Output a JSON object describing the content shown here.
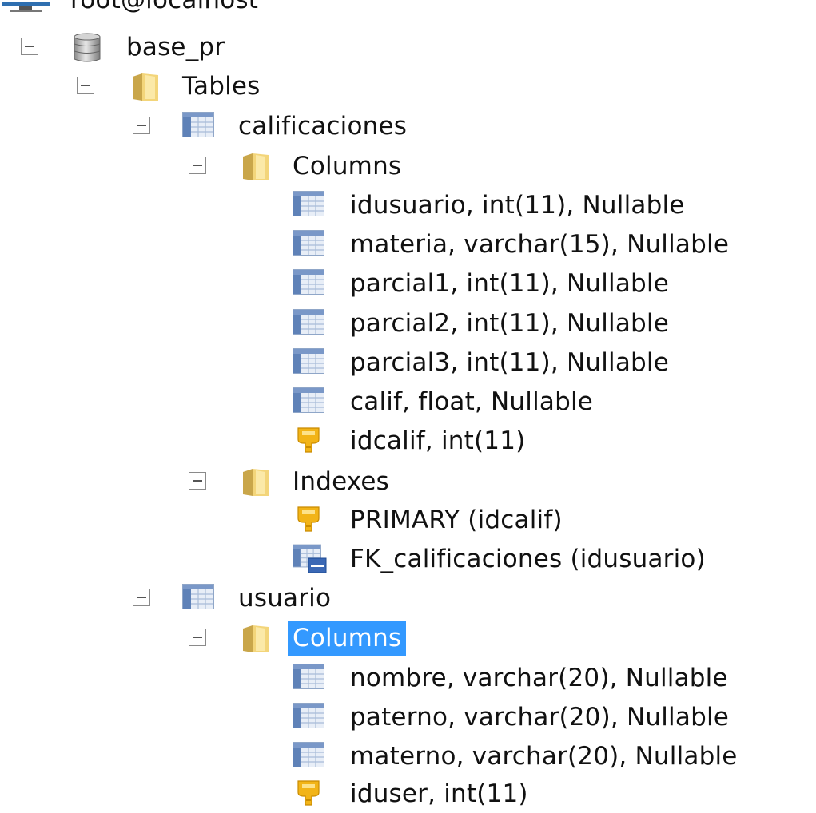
{
  "tree": {
    "connection": {
      "label": "root@localhost",
      "icon": "server-icon"
    },
    "database": {
      "label": "base_pr",
      "icon": "database-icon"
    },
    "tables_folder": {
      "label": "Tables",
      "icon": "folder-icon"
    },
    "tables": [
      {
        "name": "calificaciones",
        "columns_label": "Columns",
        "columns": [
          "idusuario, int(11), Nullable",
          "materia, varchar(15), Nullable",
          "parcial1, int(11), Nullable",
          "parcial2, int(11), Nullable",
          "parcial3, int(11), Nullable",
          "calif, float, Nullable",
          "idcalif, int(11)"
        ],
        "indexes_label": "Indexes",
        "indexes": [
          "PRIMARY (idcalif)",
          "FK_calificaciones (idusuario)"
        ]
      },
      {
        "name": "usuario",
        "columns_label": "Columns",
        "columns": [
          "nombre, varchar(20), Nullable",
          "paterno, varchar(20), Nullable",
          "materno, varchar(20), Nullable",
          "iduser, int(11)"
        ]
      }
    ]
  },
  "selection": {
    "node": "Columns",
    "color": "#3399ff"
  }
}
